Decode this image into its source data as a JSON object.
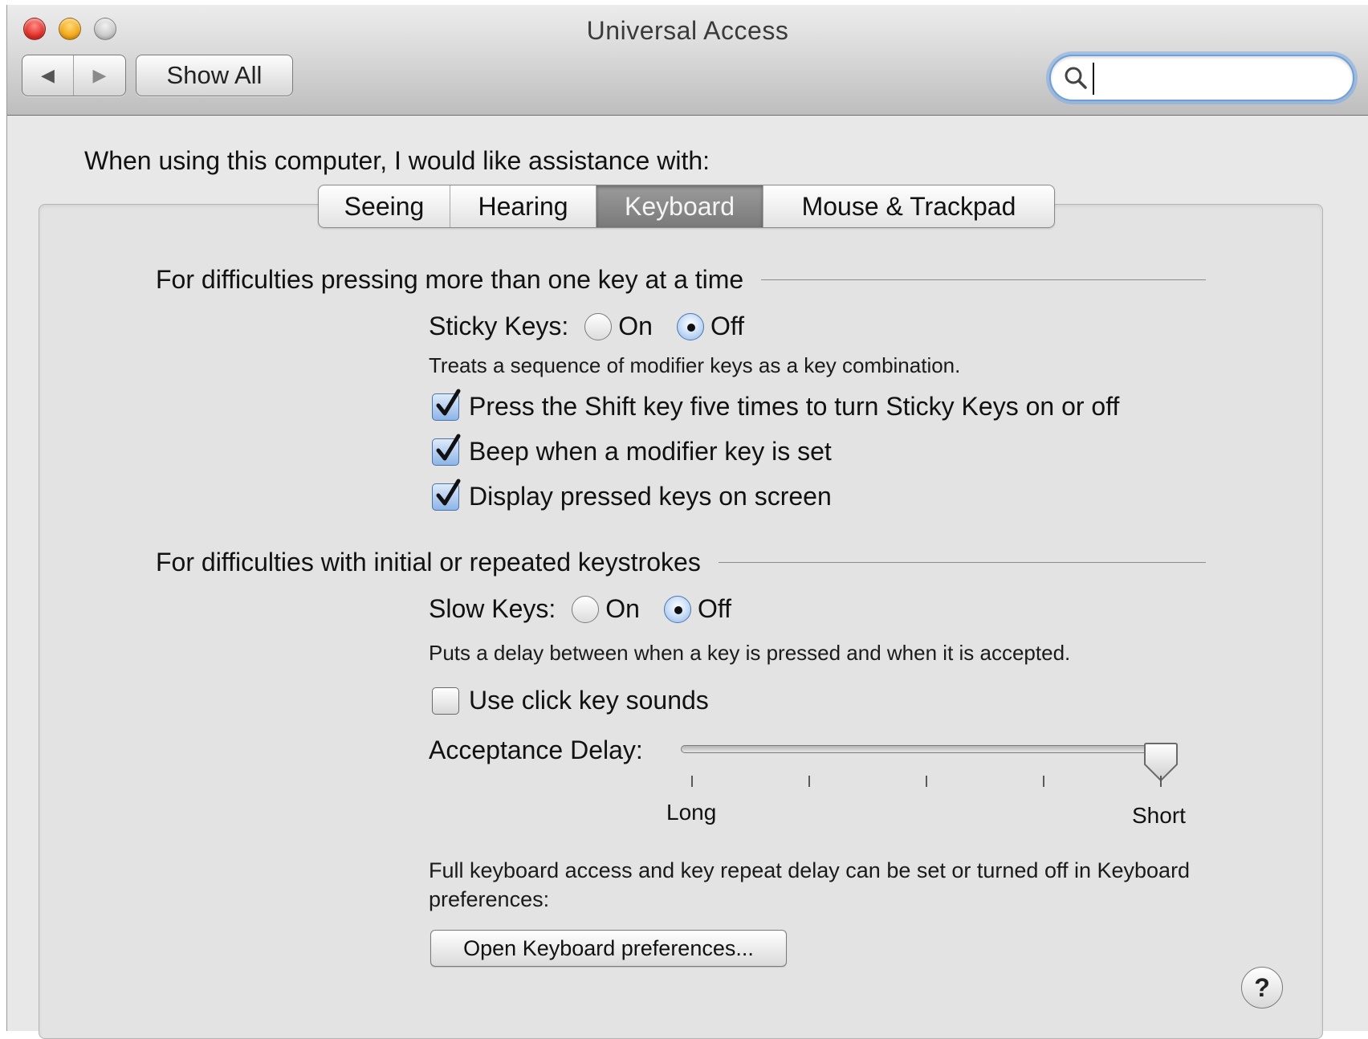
{
  "window": {
    "title": "Universal Access",
    "show_all_label": "Show All",
    "search": {
      "value": "",
      "placeholder": ""
    },
    "nav": {
      "back_glyph": "◀",
      "forward_glyph": "▶"
    }
  },
  "assist_label": "When using this computer, I would like assistance with:",
  "tabs": [
    {
      "label": "Seeing",
      "active": false
    },
    {
      "label": "Hearing",
      "active": false
    },
    {
      "label": "Keyboard",
      "active": true
    },
    {
      "label": "Mouse & Trackpad",
      "active": false
    }
  ],
  "sticky": {
    "heading": "For difficulties pressing more than one key at a time",
    "label": "Sticky Keys:",
    "on_label": "On",
    "off_label": "Off",
    "selected": "Off",
    "description": "Treats a sequence of modifier keys as a key combination.",
    "options": [
      {
        "label": "Press the Shift key five times to turn Sticky Keys on or off",
        "checked": true
      },
      {
        "label": "Beep when a modifier key is set",
        "checked": true
      },
      {
        "label": "Display pressed keys on screen",
        "checked": true
      }
    ]
  },
  "slow": {
    "heading": "For difficulties with initial or repeated keystrokes",
    "label": "Slow Keys:",
    "on_label": "On",
    "off_label": "Off",
    "selected": "Off",
    "description": "Puts a delay between when a key is pressed and when it is accepted.",
    "click_sounds": {
      "label": "Use click key sounds",
      "checked": false
    },
    "acceptance_delay": {
      "label": "Acceptance Delay:",
      "min_label": "Long",
      "max_label": "Short",
      "value_fraction": 1.0,
      "tick_count": 5
    }
  },
  "keyboard_note": "Full keyboard access and key repeat delay can be set or turned off in Keyboard preferences:",
  "open_keyboard_button": "Open Keyboard preferences...",
  "help_label": "?",
  "colors": {
    "accent": "#6d9fd8",
    "window_bg": "#e8e8e8",
    "active_tab": "#8a8a8a"
  }
}
